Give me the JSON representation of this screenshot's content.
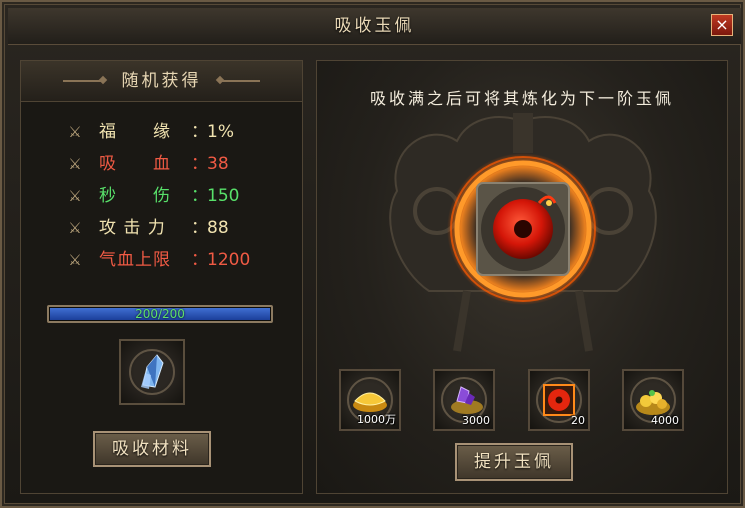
{
  "window": {
    "title": "吸收玉佩",
    "close_label": "×"
  },
  "left_panel": {
    "title": "随机获得",
    "stats": [
      {
        "label": "福　　缘",
        "value": "1%",
        "color": "#f1e3b0"
      },
      {
        "label": "吸　　血",
        "value": "38",
        "color": "#f05a44"
      },
      {
        "label": "秒　　伤",
        "value": "150",
        "color": "#58e06a"
      },
      {
        "label": "攻 击 力",
        "value": "88",
        "color": "#f1e3b0"
      },
      {
        "label": "气血上限",
        "value": "1200",
        "color": "#f05a44"
      }
    ],
    "stat_colon": "：",
    "progress": {
      "text": "200/200",
      "fraction": 1.0
    },
    "material_icon": "crystal-icon",
    "absorb_button": "吸收材料"
  },
  "right_panel": {
    "hint": "吸收满之后可将其炼化为下一阶玉佩",
    "jade_icon": "jade-pendant-icon",
    "materials": [
      {
        "icon": "gold-ingot-icon",
        "count": "1000万"
      },
      {
        "icon": "purple-gem-icon",
        "count": "3000"
      },
      {
        "icon": "jade-pendant-icon",
        "count": "20"
      },
      {
        "icon": "gold-pile-icon",
        "count": "4000"
      }
    ],
    "upgrade_button": "提升玉佩"
  }
}
